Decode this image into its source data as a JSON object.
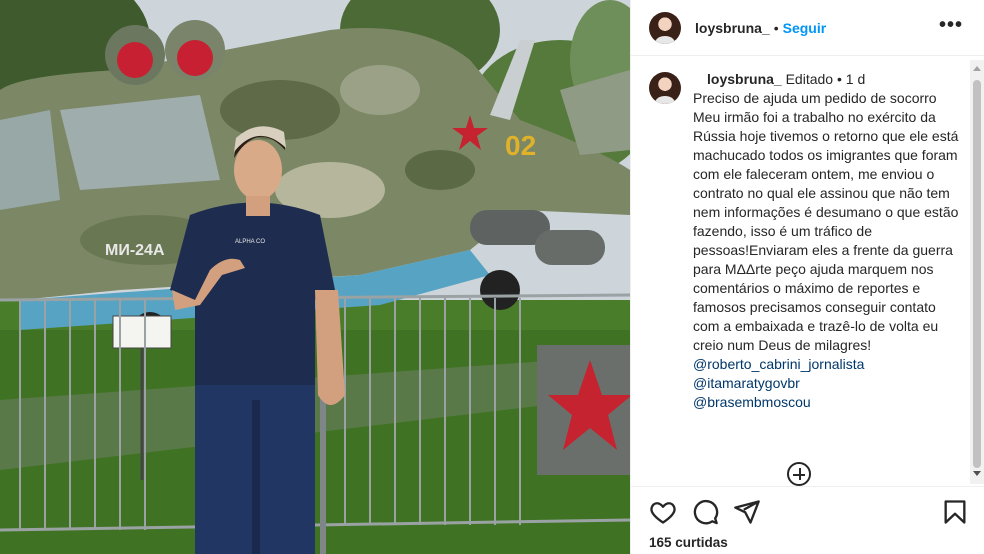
{
  "post": {
    "author": "loysbruna_",
    "follow_label": "Seguir",
    "separator": "•",
    "more_label": "•••",
    "caption": {
      "author": "loysbruna_",
      "edited_label": "Editado",
      "separator": "•",
      "time": "1 d",
      "text": "Preciso de ajuda um pedido de socorro\nMeu irmão foi a trabalho no exército da Rússia hoje tivemos o retorno que ele está machucado todos os imigrantes que foram com ele faleceram ontem, me enviou o contrato no qual ele assinou que não tem nem informações é desumano o que estão fazendo, isso é um tráfico de pessoas!Enviaram eles a frente da guerra para MΔΔrte peço ajuda marquem nos comentários o máximo de reportes e famosos precisamos conseguir contato com a embaixada e trazê-lo de volta eu creio num Deus de milagres!",
      "mentions": [
        "@roberto_cabrini_jornalista",
        "@itamaratygovbr",
        "@brasembmoscou"
      ]
    },
    "likes": "165 curtidas"
  },
  "photo": {
    "helicopter_label": "МИ-24А",
    "tail_number": "02",
    "shirt_text": "ALPHA CO"
  },
  "icons": {
    "header_avatar": "avatar-icon",
    "more": "more-options-icon",
    "add_comment": "add-circle-icon",
    "like": "heart-icon",
    "comment": "comment-bubble-icon",
    "share": "paper-plane-icon",
    "save": "bookmark-icon"
  },
  "colors": {
    "link": "#0095f6",
    "mention": "#00376b",
    "muted": "#737373",
    "text": "#262626"
  }
}
